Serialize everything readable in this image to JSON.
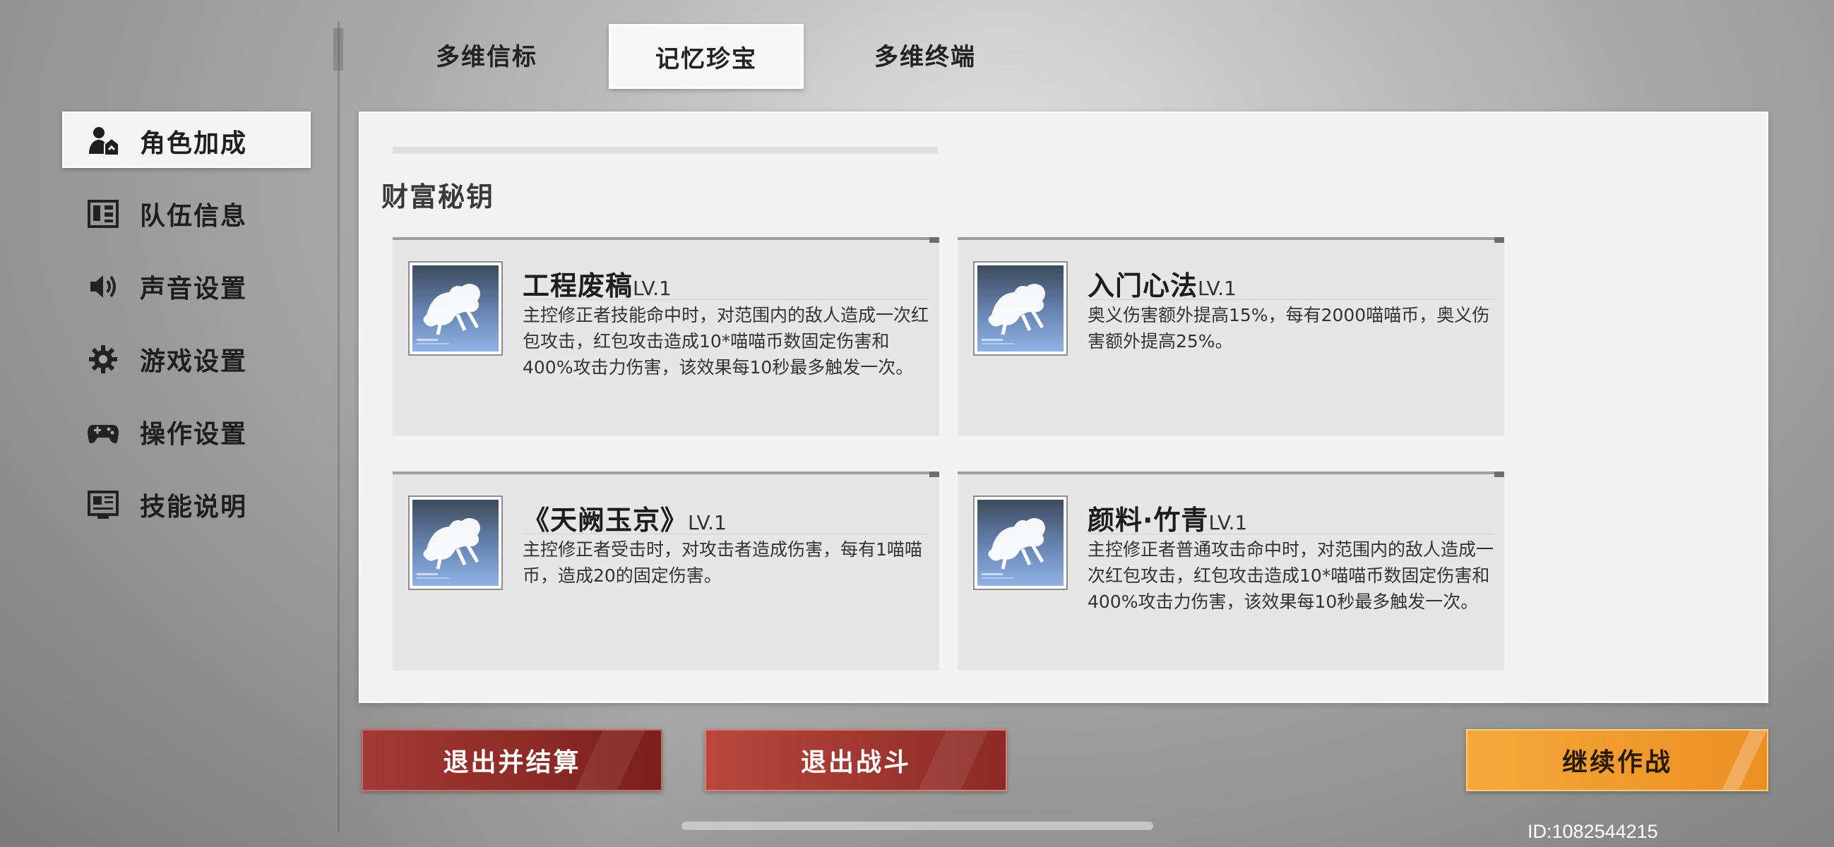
{
  "tabs": [
    {
      "label": "多维信标"
    },
    {
      "label": "记忆珍宝"
    },
    {
      "label": "多维终端"
    }
  ],
  "sidebar": {
    "items": [
      {
        "label": "角色加成",
        "icon": "character-bonus-icon"
      },
      {
        "label": "队伍信息",
        "icon": "team-info-icon"
      },
      {
        "label": "声音设置",
        "icon": "speaker-icon"
      },
      {
        "label": "游戏设置",
        "icon": "gear-icon"
      },
      {
        "label": "操作设置",
        "icon": "gamepad-icon"
      },
      {
        "label": "技能说明",
        "icon": "skill-info-icon"
      }
    ]
  },
  "main": {
    "section_title": "财富秘钥",
    "cards": [
      {
        "title": "工程废稿",
        "level": "LV.1",
        "description": "主控修正者技能命中时，对范围内的敌人造成一次红包攻击，红包攻击造成10*喵喵币数固定伤害和400%攻击力伤害，该效果每10秒最多触发一次。",
        "icon": "qilin-icon"
      },
      {
        "title": "入门心法",
        "level": "LV.1",
        "description": "奥义伤害额外提高15%，每有2000喵喵币，奥义伤害额外提高25%。",
        "icon": "qilin-icon"
      },
      {
        "title": "《天阙玉京》",
        "level": "LV.1",
        "description": "主控修正者受击时，对攻击者造成伤害，每有1喵喵币，造成20的固定伤害。",
        "icon": "qilin-icon"
      },
      {
        "title": "颜料·竹青",
        "level": "LV.1",
        "description": "主控修正者普通攻击命中时，对范围内的敌人造成一次红包攻击，红包攻击造成10*喵喵币数固定伤害和400%攻击力伤害，该效果每10秒最多触发一次。",
        "icon": "qilin-icon"
      }
    ]
  },
  "buttons": {
    "exit_settle": "退出并结算",
    "exit_battle": "退出战斗",
    "continue": "继续作战"
  },
  "id_text": "ID:1082544215",
  "colors": {
    "accent_orange": "#f0a030",
    "danger_red": "#8b2a26",
    "panel_bg": "#f3f3f3",
    "card_bg": "#e6e6e6"
  }
}
